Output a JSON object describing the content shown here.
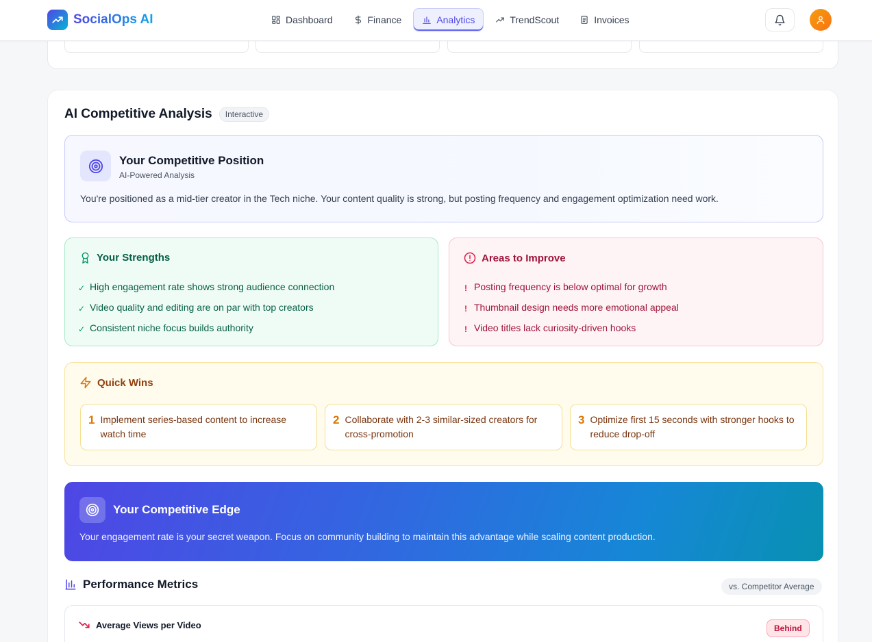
{
  "brand": {
    "name": "SocialOps AI"
  },
  "nav": {
    "items": [
      {
        "label": "Dashboard",
        "icon": "grid-icon"
      },
      {
        "label": "Finance",
        "icon": "dollar-icon"
      },
      {
        "label": "Analytics",
        "icon": "bar-chart-icon",
        "active": true
      },
      {
        "label": "TrendScout",
        "icon": "trending-up-icon"
      },
      {
        "label": "Invoices",
        "icon": "document-icon"
      }
    ]
  },
  "analysis": {
    "title": "AI Competitive Analysis",
    "badge": "Interactive",
    "position": {
      "title": "Your Competitive Position",
      "subtitle": "AI-Powered Analysis",
      "text": "You're positioned as a mid-tier creator in the Tech niche. Your content quality is strong, but posting frequency and engagement optimization need work."
    },
    "strengths": {
      "title": "Your Strengths",
      "items": [
        "High engagement rate shows strong audience connection",
        "Video quality and editing are on par with top creators",
        "Consistent niche focus builds authority"
      ]
    },
    "improve": {
      "title": "Areas to Improve",
      "items": [
        "Posting frequency is below optimal for growth",
        "Thumbnail design needs more emotional appeal",
        "Video titles lack curiosity-driven hooks"
      ]
    },
    "quick_wins": {
      "title": "Quick Wins",
      "items": [
        {
          "num": "1",
          "text": "Implement series-based content to increase watch time"
        },
        {
          "num": "2",
          "text": "Collaborate with 2-3 similar-sized creators for cross-promotion"
        },
        {
          "num": "3",
          "text": "Optimize first 15 seconds with stronger hooks to reduce drop-off"
        }
      ]
    },
    "edge": {
      "title": "Your Competitive Edge",
      "text": "Your engagement rate is your secret weapon. Focus on community building to maintain this advantage while scaling content production."
    },
    "metrics": {
      "title": "Performance Metrics",
      "comparison": "vs. Competitor Average",
      "rows": [
        {
          "name": "Average Views per Video",
          "status": "Behind"
        }
      ]
    }
  },
  "colors": {
    "accent": "#4f46e5",
    "success": "#059669",
    "danger": "#e11d48",
    "warning": "#d97706"
  }
}
